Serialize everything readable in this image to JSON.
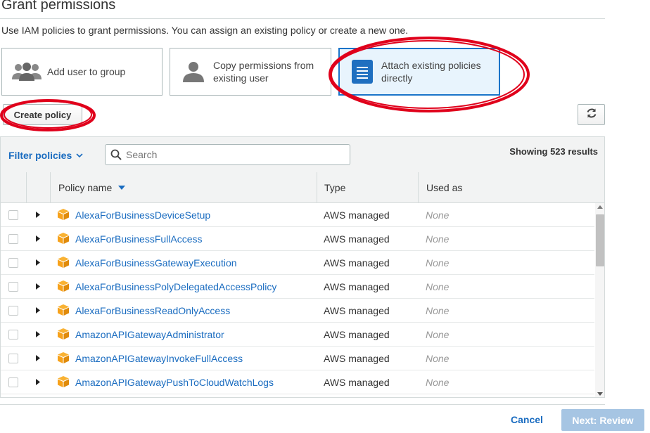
{
  "header": {
    "title": "Grant permissions",
    "subtitle": "Use IAM policies to grant permissions. You can assign an existing policy or create a new one."
  },
  "options": [
    {
      "label": "Add user to group",
      "icon": "group-icon",
      "selected": false
    },
    {
      "label": "Copy permissions from existing user",
      "line1": "Copy permissions from",
      "line2": "existing user",
      "icon": "user-icon",
      "selected": false
    },
    {
      "label": "Attach existing policies directly",
      "line1": "Attach existing policies",
      "line2": "directly",
      "icon": "document-icon",
      "selected": true
    }
  ],
  "toolbar": {
    "create_policy_label": "Create policy",
    "refresh_icon": "refresh-icon"
  },
  "filter": {
    "label": "Filter policies",
    "search_placeholder": "Search",
    "search_value": "",
    "showing": "Showing 523 results"
  },
  "table": {
    "columns": [
      "Policy name",
      "Type",
      "Used as"
    ],
    "sort_column": "Policy name",
    "sort_direction": "descending",
    "rows": [
      {
        "name": "AlexaForBusinessDeviceSetup",
        "type": "AWS managed",
        "used_as": "None"
      },
      {
        "name": "AlexaForBusinessFullAccess",
        "type": "AWS managed",
        "used_as": "None"
      },
      {
        "name": "AlexaForBusinessGatewayExecution",
        "type": "AWS managed",
        "used_as": "None"
      },
      {
        "name": "AlexaForBusinessPolyDelegatedAccessPolicy",
        "type": "AWS managed",
        "used_as": "None"
      },
      {
        "name": "AlexaForBusinessReadOnlyAccess",
        "type": "AWS managed",
        "used_as": "None"
      },
      {
        "name": "AmazonAPIGatewayAdministrator",
        "type": "AWS managed",
        "used_as": "None"
      },
      {
        "name": "AmazonAPIGatewayInvokeFullAccess",
        "type": "AWS managed",
        "used_as": "None"
      },
      {
        "name": "AmazonAPIGatewayPushToCloudWatchLogs",
        "type": "AWS managed",
        "used_as": "None"
      }
    ]
  },
  "footer": {
    "cancel_label": "Cancel",
    "next_label": "Next: Review"
  },
  "colors": {
    "link": "#1a6cc0",
    "selected_border": "#1a74c9",
    "selected_bg": "#e8f4fd",
    "policy_box": "#f7a21b",
    "annotation": "#e0001b",
    "next_disabled": "#a6c5e3"
  }
}
